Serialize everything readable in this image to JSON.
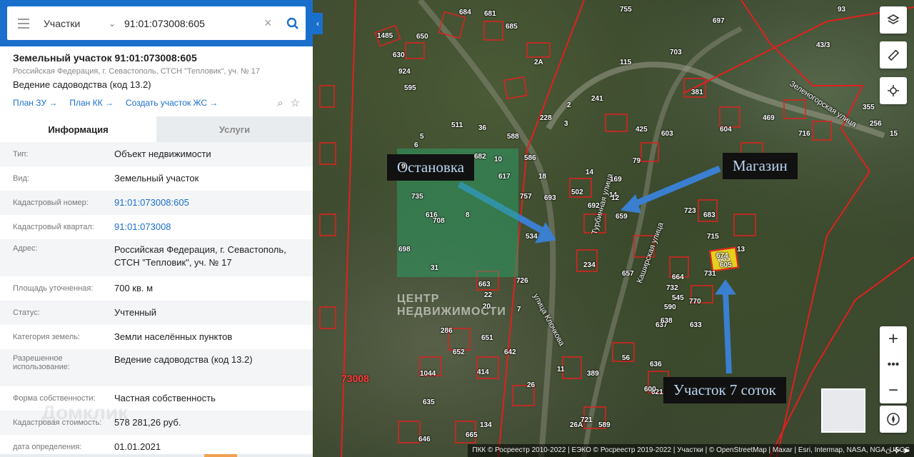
{
  "search": {
    "category": "Участки",
    "query": "91:01:073008:605"
  },
  "object": {
    "title": "Земельный участок 91:01:073008:605",
    "address_short": "Российская Федерация, г. Севастополь, СТСН \"Тепловик\", уч. № 17",
    "use": "Ведение садоводства (код 13.2)",
    "links": [
      "План ЗУ →",
      "План КК →",
      "Создать участок ЖС →"
    ]
  },
  "tabs": [
    "Информация",
    "Услуги"
  ],
  "rows": [
    {
      "key": "Тип:",
      "value": "Объект недвижимости"
    },
    {
      "key": "Вид:",
      "value": "Земельный участок"
    },
    {
      "key": "Кадастровый номер:",
      "value": "91:01:073008:605"
    },
    {
      "key": "Кадастровый квартал:",
      "value": "91:01:073008"
    },
    {
      "key": "Адрес:",
      "value": "Российская Федерация, г. Севастополь, СТСН \"Тепловик\", уч. № 17"
    },
    {
      "key": "Площадь уточненная:",
      "value": "700 кв. м"
    },
    {
      "key": "Статус:",
      "value": "Учтенный"
    },
    {
      "key": "Категория земель:",
      "value": "Земли населённых пунктов"
    },
    {
      "key": "Разрешенное использование:",
      "value": "Ведение садоводства (код 13.2)"
    },
    {
      "key": "Форма собственности:",
      "value": "Частная собственность"
    },
    {
      "key": "Кадастровая стоимость:",
      "value": "578 281,26 руб."
    },
    {
      "key": "дата определения:",
      "value": "01.01.2021"
    }
  ],
  "map": {
    "callouts": {
      "stop": "Остановка",
      "shop": "Магазин",
      "plot": "Участок 7 соток"
    },
    "selected_parcel": "605",
    "quarter_label": "73008",
    "watermark": "ЦЕНТР\nНЕДВИЖИМОСТИ",
    "panel_watermark": "Домклик",
    "streets": [
      "Турбинная улица",
      "Каширская улица",
      "улица Клочкова",
      "Зеленогорская улица"
    ],
    "parcel_labels": [
      "1485",
      "630",
      "650",
      "924",
      "595",
      "684",
      "681",
      "685",
      "755",
      "697",
      "93",
      "43/3",
      "2А",
      "703",
      "115",
      "241",
      "381",
      "355",
      "228",
      "588",
      "425",
      "603",
      "604",
      "469",
      "716",
      "256",
      "15",
      "511",
      "36",
      "10",
      "586",
      "682",
      "18",
      "757",
      "14",
      "14",
      "502",
      "169",
      "79",
      "735",
      "616",
      "617",
      "12",
      "13",
      "692",
      "693",
      "659",
      "723",
      "683",
      "708",
      "20",
      "534",
      "715",
      "674",
      "605",
      "731",
      "698",
      "31",
      "234",
      "664",
      "732",
      "545",
      "770",
      "637",
      "663",
      "22",
      "726",
      "590",
      "657",
      "638",
      "633",
      "286",
      "642",
      "651",
      "652",
      "56",
      "414",
      "389",
      "1044",
      "26",
      "636",
      "621",
      "635",
      "600",
      "26А",
      "721",
      "589",
      "646",
      "665",
      "134",
      "11",
      "7",
      "8",
      "3",
      "2",
      "6",
      "5",
      "9"
    ],
    "attribution": "ПКК © Росреестр 2010-2022 | ЕЭКО © Росреестр 2019-2022 | Участки | © OpenStreetMap | Maxar | Esri, Intermap, NASA, NGA, USGS"
  },
  "colors": {
    "accent": "#1a6fcc",
    "parcel_border": "#e02020",
    "selected_parcel": "#e6cf1e",
    "arrow": "#3a7fd0"
  }
}
